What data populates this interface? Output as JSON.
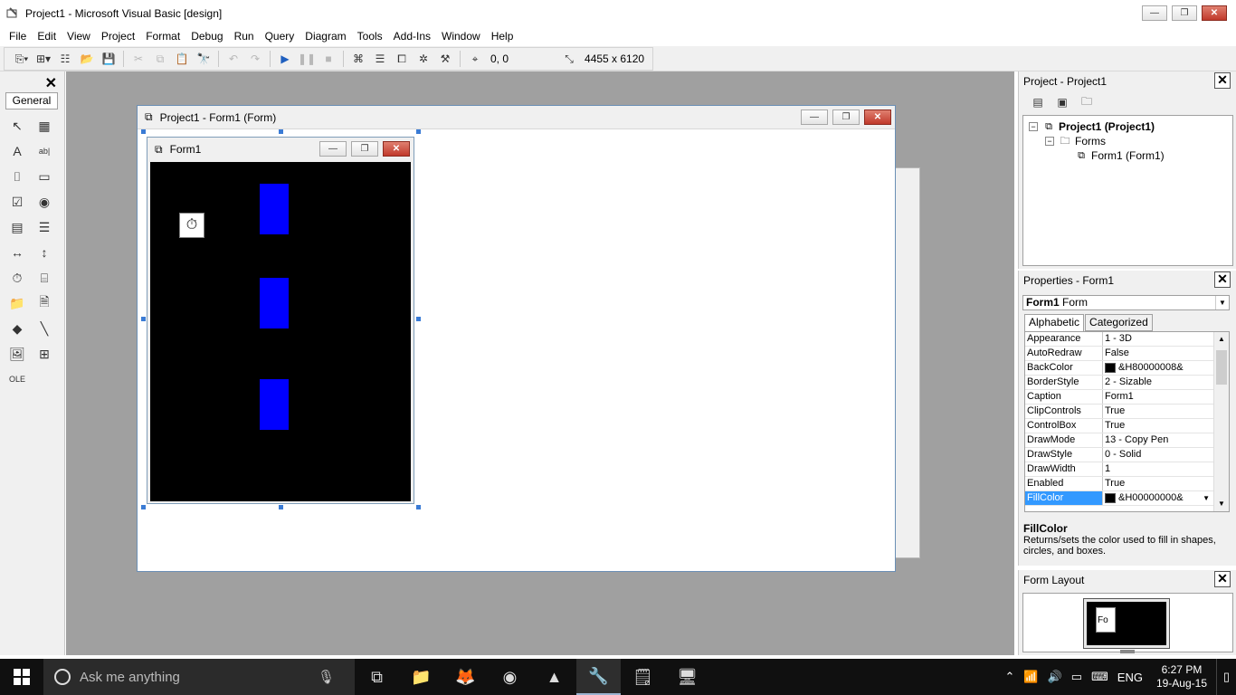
{
  "window": {
    "title": "Project1 - Microsoft Visual Basic [design]",
    "minimize": "—",
    "restore": "❐",
    "close": "✕"
  },
  "menu": [
    "File",
    "Edit",
    "View",
    "Project",
    "Format",
    "Debug",
    "Run",
    "Query",
    "Diagram",
    "Tools",
    "Add-Ins",
    "Window",
    "Help"
  ],
  "toolbar": {
    "position_readout": "0, 0",
    "size_readout": "4455 x 6120"
  },
  "toolbox": {
    "close": "✕",
    "tab_label": "General",
    "tools": [
      "pointer-icon",
      "picturebox-icon",
      "label-icon",
      "textbox-icon",
      "frame-icon",
      "commandbutton-icon",
      "checkbox-icon",
      "optionbutton-icon",
      "combobox-icon",
      "listbox-icon",
      "hscrollbar-icon",
      "vscrollbar-icon",
      "timer-icon",
      "drivelistbox-icon",
      "dirlistbox-icon",
      "filelistbox-icon",
      "shape-icon",
      "line-icon",
      "image-icon",
      "data-icon",
      "ole-icon"
    ],
    "tool_glyphs": [
      "↖",
      "▦",
      "A",
      "ab|",
      "⌷",
      "▭",
      "☑",
      "◉",
      "▤",
      "☰",
      "↔",
      "↕",
      "⏱",
      "⌸",
      "📁",
      "🗎",
      "◆",
      "╲",
      "🖼",
      "⊞",
      "OLE"
    ]
  },
  "designer": {
    "title": "Project1 - Form1 (Form)",
    "form": {
      "caption": "Form1",
      "back_color": "#000000",
      "bar_color": "#0000ff"
    }
  },
  "project_explorer": {
    "title": "Project - Project1",
    "close": "✕",
    "tree": [
      {
        "label": "Project1 (Project1)",
        "level": 0,
        "expander": "−"
      },
      {
        "label": "Forms",
        "level": 1,
        "expander": "−"
      },
      {
        "label": "Form1 (Form1)",
        "level": 2,
        "expander": ""
      }
    ]
  },
  "properties": {
    "title": "Properties - Form1",
    "close": "✕",
    "object_name": "Form1",
    "object_type": "Form",
    "tabs": [
      "Alphabetic",
      "Categorized"
    ],
    "rows": [
      {
        "name": "Appearance",
        "value": "1 - 3D",
        "swatch": false
      },
      {
        "name": "AutoRedraw",
        "value": "False",
        "swatch": false
      },
      {
        "name": "BackColor",
        "value": "&H80000008&",
        "swatch": true
      },
      {
        "name": "BorderStyle",
        "value": "2 - Sizable",
        "swatch": false
      },
      {
        "name": "Caption",
        "value": "Form1",
        "swatch": false
      },
      {
        "name": "ClipControls",
        "value": "True",
        "swatch": false
      },
      {
        "name": "ControlBox",
        "value": "True",
        "swatch": false
      },
      {
        "name": "DrawMode",
        "value": "13 - Copy Pen",
        "swatch": false
      },
      {
        "name": "DrawStyle",
        "value": "0 - Solid",
        "swatch": false
      },
      {
        "name": "DrawWidth",
        "value": "1",
        "swatch": false
      },
      {
        "name": "Enabled",
        "value": "True",
        "swatch": false
      },
      {
        "name": "FillColor",
        "value": "&H00000000&",
        "swatch": true
      }
    ],
    "selected_row": "FillColor",
    "description_title": "FillColor",
    "description_text": "Returns/sets the color used to fill in shapes, circles, and boxes."
  },
  "form_layout": {
    "title": "Form Layout",
    "close": "✕",
    "mini_form_label": "Fo"
  },
  "taskbar": {
    "search_placeholder": "Ask me anything",
    "apps": [
      "task-view-icon",
      "file-explorer-icon",
      "firefox-icon",
      "chrome-icon",
      "vlc-icon",
      "visual-basic-icon",
      "notepad-icon",
      "app-icon"
    ],
    "app_glyphs": [
      "⧉",
      "📁",
      "🦊",
      "◉",
      "▲",
      "🔧",
      "🗒",
      "🖥"
    ],
    "active_app": "visual-basic-icon",
    "language": "ENG",
    "time": "6:27 PM",
    "date": "19-Aug-15"
  }
}
